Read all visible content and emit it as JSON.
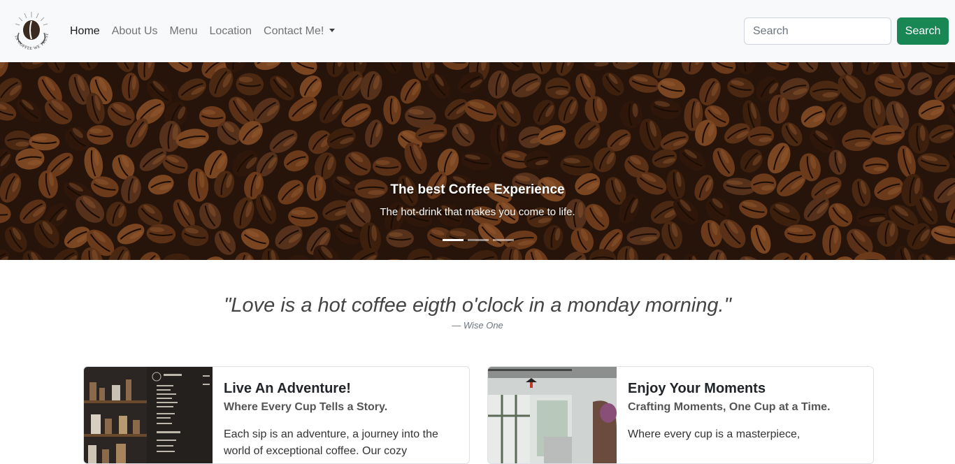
{
  "brand": {
    "logo_ring_text": "IN COFFEE WE TRUST"
  },
  "nav": {
    "links": [
      {
        "label": "Home",
        "active": true
      },
      {
        "label": "About Us"
      },
      {
        "label": "Menu"
      },
      {
        "label": "Location"
      },
      {
        "label": "Contact Me!"
      }
    ]
  },
  "search": {
    "placeholder": "Search",
    "button_label": "Search"
  },
  "hero": {
    "title": "The best Coffee Experience",
    "subtitle": "The hot-drink that makes you come to life.",
    "slide_count": 3,
    "active_slide": 1
  },
  "quote": {
    "text": "\"Love is a hot coffee eigth o'clock in a monday morning.\"",
    "author": "— Wise One"
  },
  "cards": [
    {
      "title": "Live An Adventure!",
      "subtitle": "Where Every Cup Tells a Story.",
      "text": "Each sip is an adventure, a journey into the world of exceptional coffee. Our cozy"
    },
    {
      "title": "Enjoy Your Moments",
      "subtitle": "Crafting Moments, One Cup at a Time.",
      "text": "Where every cup is a masterpiece,"
    }
  ],
  "colors": {
    "accent": "#198754",
    "navbar_bg": "#f8f9fa"
  }
}
